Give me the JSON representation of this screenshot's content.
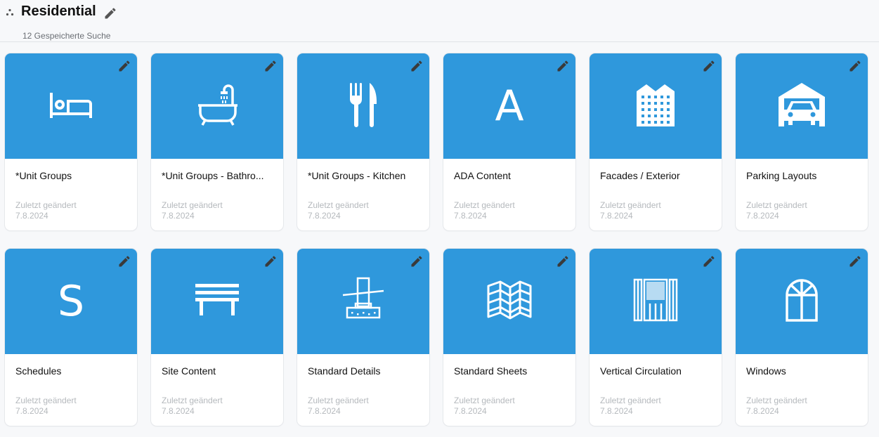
{
  "header": {
    "title": "Residential",
    "subtitle": "12 Gespeicherte Suche",
    "drag_icon": "drag-handle-icon",
    "edit_icon": "pencil-icon"
  },
  "colors": {
    "card_accent": "#2f98dc",
    "meta_text": "#b5b9bd",
    "edit_icon": "#3a3a3a"
  },
  "cards": [
    {
      "name": "*Unit Groups",
      "meta_label": "Zuletzt geändert",
      "meta_date": "7.8.2024",
      "icon": "bed-icon"
    },
    {
      "name": "*Unit Groups - Bathro...",
      "meta_label": "Zuletzt geändert",
      "meta_date": "7.8.2024",
      "icon": "bathtub-icon"
    },
    {
      "name": "*Unit Groups - Kitchen",
      "meta_label": "Zuletzt geändert",
      "meta_date": "7.8.2024",
      "icon": "fork-knife-icon"
    },
    {
      "name": "ADA Content",
      "meta_label": "Zuletzt geändert",
      "meta_date": "7.8.2024",
      "icon": "letter-a-icon",
      "icon_letter": "A"
    },
    {
      "name": "Facades / Exterior",
      "meta_label": "Zuletzt geändert",
      "meta_date": "7.8.2024",
      "icon": "building-icon"
    },
    {
      "name": "Parking Layouts",
      "meta_label": "Zuletzt geändert",
      "meta_date": "7.8.2024",
      "icon": "garage-car-icon"
    },
    {
      "name": "Schedules",
      "meta_label": "Zuletzt geändert",
      "meta_date": "7.8.2024",
      "icon": "letter-s-icon",
      "icon_letter": "S"
    },
    {
      "name": "Site Content",
      "meta_label": "Zuletzt geändert",
      "meta_date": "7.8.2024",
      "icon": "bench-icon"
    },
    {
      "name": "Standard Details",
      "meta_label": "Zuletzt geändert",
      "meta_date": "7.8.2024",
      "icon": "footing-detail-icon"
    },
    {
      "name": "Standard Sheets",
      "meta_label": "Zuletzt geändert",
      "meta_date": "7.8.2024",
      "icon": "folded-map-icon"
    },
    {
      "name": "Vertical Circulation",
      "meta_label": "Zuletzt geändert",
      "meta_date": "7.8.2024",
      "icon": "elevator-shaft-icon"
    },
    {
      "name": "Windows",
      "meta_label": "Zuletzt geändert",
      "meta_date": "7.8.2024",
      "icon": "arched-window-icon"
    }
  ]
}
